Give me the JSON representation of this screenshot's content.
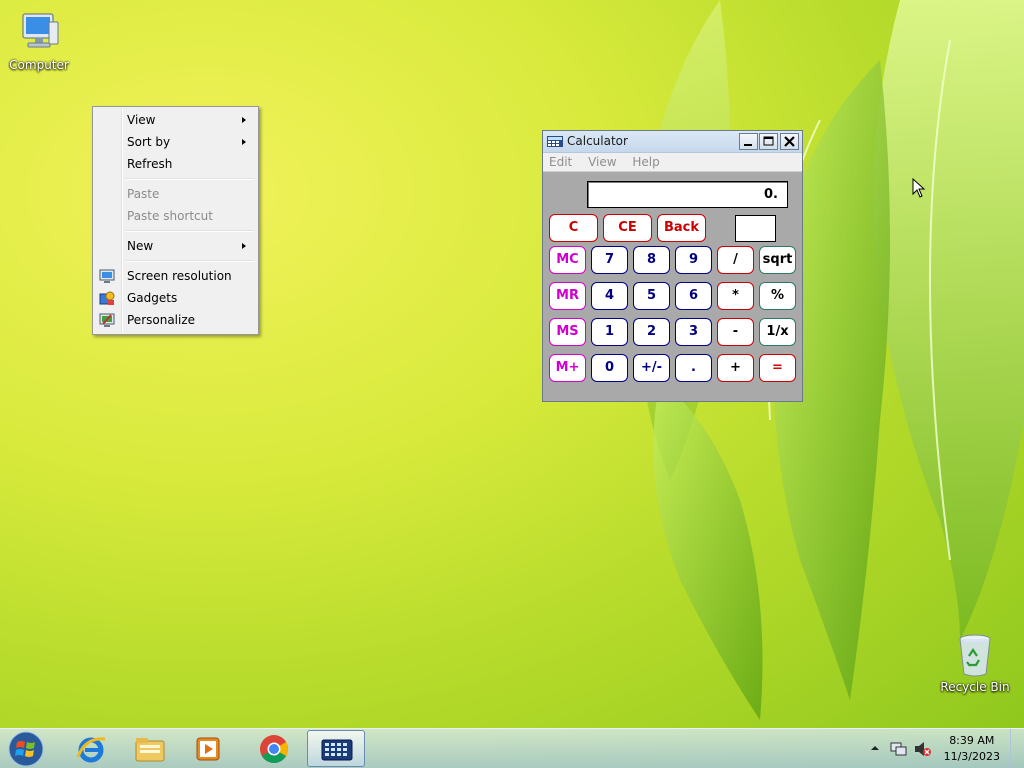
{
  "desktop": {
    "icons": [
      {
        "label": "Computer",
        "icon": "computer-icon"
      },
      {
        "label": "Recycle Bin",
        "icon": "recycle-bin-icon"
      }
    ]
  },
  "context_menu": {
    "items": [
      {
        "label": "View",
        "submenu": true,
        "enabled": true
      },
      {
        "label": "Sort by",
        "submenu": true,
        "enabled": true
      },
      {
        "label": "Refresh",
        "submenu": false,
        "enabled": true
      },
      {
        "label": "Paste",
        "submenu": false,
        "enabled": false
      },
      {
        "label": "Paste shortcut",
        "submenu": false,
        "enabled": false
      },
      {
        "label": "New",
        "submenu": true,
        "enabled": true
      },
      {
        "label": "Screen resolution",
        "icon": "monitor-icon",
        "enabled": true
      },
      {
        "label": "Gadgets",
        "icon": "gadgets-icon",
        "enabled": true
      },
      {
        "label": "Personalize",
        "icon": "personalize-icon",
        "enabled": true
      }
    ]
  },
  "calculator": {
    "title": "Calculator",
    "menu": [
      "Edit",
      "View",
      "Help"
    ],
    "display": "0.",
    "memory_indicator": "",
    "buttons": {
      "c": "C",
      "ce": "CE",
      "back": "Back",
      "mc": "MC",
      "mr": "MR",
      "ms": "MS",
      "mplus": "M+",
      "n7": "7",
      "n8": "8",
      "n9": "9",
      "div": "/",
      "sqrt": "sqrt",
      "n4": "4",
      "n5": "5",
      "n6": "6",
      "mul": "*",
      "pct": "%",
      "n1": "1",
      "n2": "2",
      "n3": "3",
      "sub": "-",
      "recip": "1/x",
      "n0": "0",
      "sign": "+/-",
      "dot": ".",
      "add": "+",
      "eq": "="
    }
  },
  "taskbar": {
    "pinned": [
      "internet-explorer-icon",
      "windows-explorer-icon",
      "media-player-icon",
      "chrome-icon",
      "calculator-icon"
    ],
    "clock_time": "8:39 AM",
    "clock_date": "11/3/2023"
  },
  "colors": {
    "calc_red": "#cc0000",
    "calc_blue": "#000080",
    "calc_magenta": "#d000d0"
  }
}
